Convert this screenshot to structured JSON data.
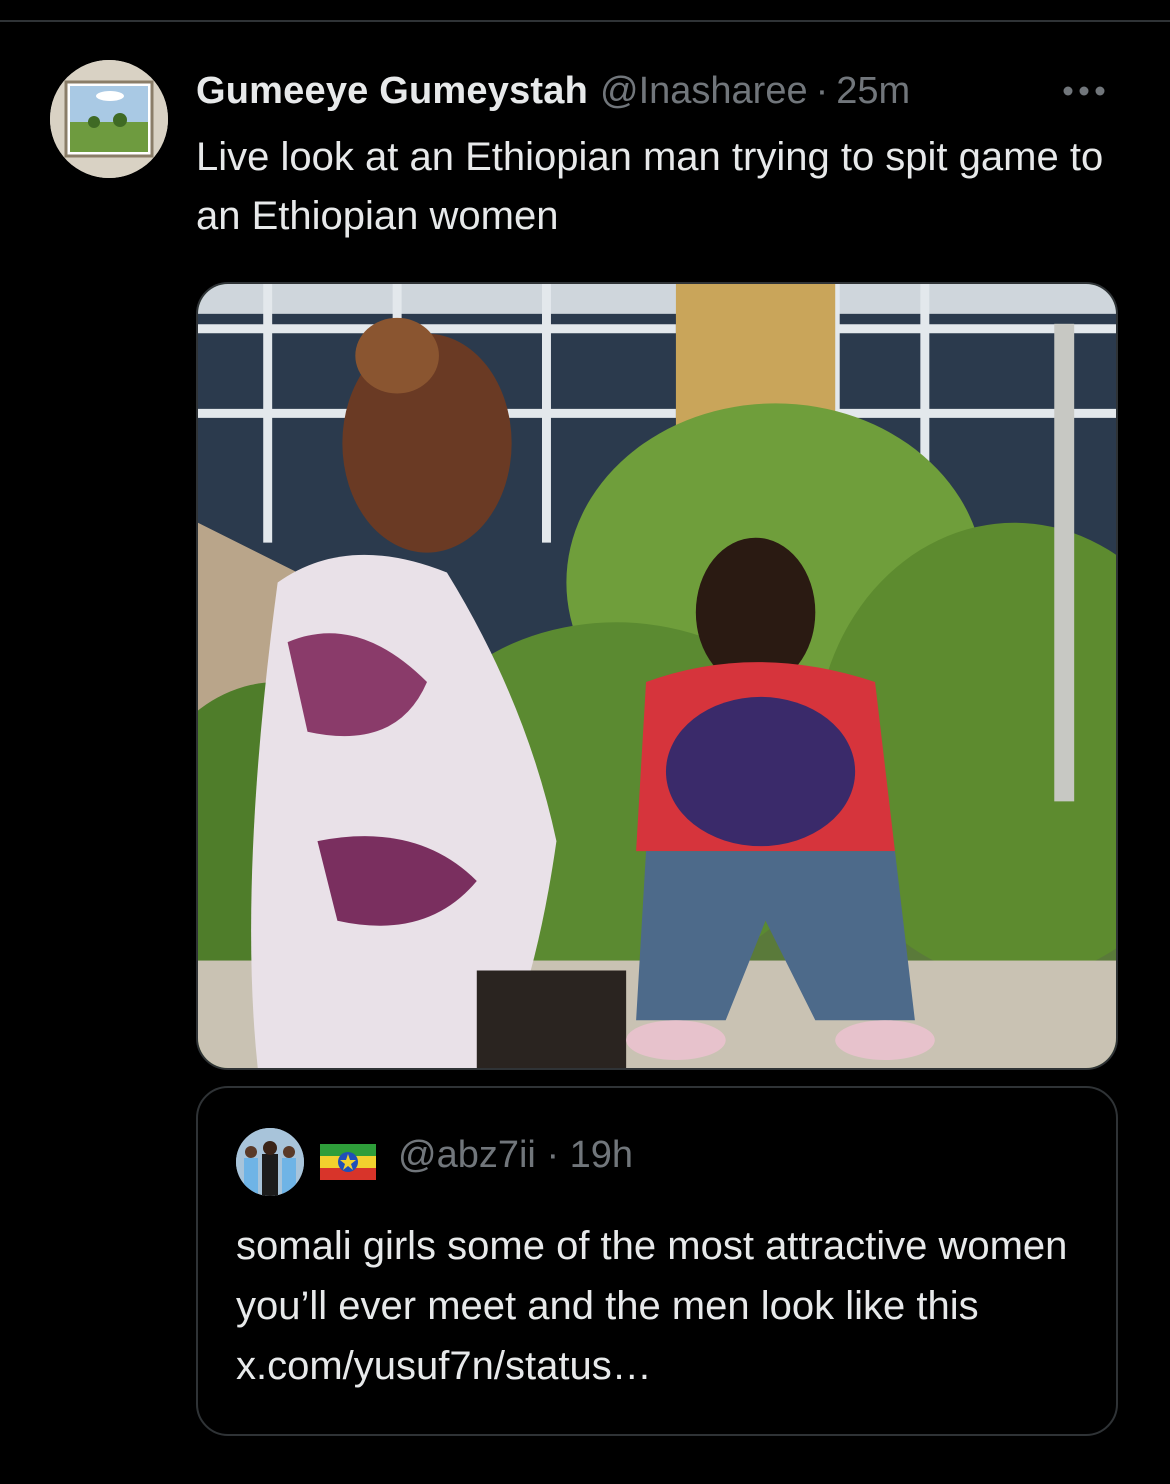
{
  "tweet": {
    "author_name": "Gumeeye Gumeystah",
    "handle": "@Inasharee",
    "separator": "·",
    "time": "25m",
    "text": "Live look at an Ethiopian man trying to spit game to an Ethiopian women",
    "more_icon": "more-horizontal-icon",
    "quote": {
      "handle": "@abz7ii",
      "separator": "·",
      "time": "19h",
      "flag_icon": "ethiopia-flag-icon",
      "text": "somali girls some of the most attractive women you’ll ever meet and the men look like this x.com/yusuf7n/status…"
    }
  },
  "colors": {
    "background": "#000000",
    "text_primary": "#e7e9ea",
    "text_secondary": "#71767b",
    "border": "#2f3336"
  }
}
